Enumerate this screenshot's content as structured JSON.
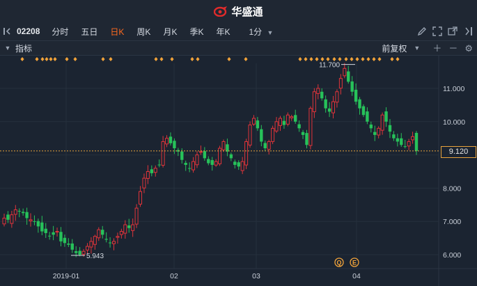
{
  "app": {
    "title": "华盛通"
  },
  "toolbar": {
    "stock_code": "02208",
    "periods": [
      {
        "label": "分时",
        "active": false
      },
      {
        "label": "五日",
        "active": false
      },
      {
        "label": "日K",
        "active": true
      },
      {
        "label": "周K",
        "active": false
      },
      {
        "label": "月K",
        "active": false
      },
      {
        "label": "季K",
        "active": false
      },
      {
        "label": "年K",
        "active": false
      }
    ],
    "minute_select": "1分"
  },
  "indicator_bar": {
    "label": "指标",
    "adjust_mode": "前复权"
  },
  "colors": {
    "up": "#e0343a",
    "down": "#27c25a",
    "accent": "#ff6a1f",
    "marker": "#f1a33a",
    "current_price_line": "#e8a33c"
  },
  "chart_data": {
    "type": "candlestick",
    "y_ticks": [
      "11.000",
      "10.000",
      "9.000",
      "8.000",
      "7.000",
      "6.000"
    ],
    "ylim": [
      5.55,
      12.0
    ],
    "x_ticks": [
      "2019-01",
      "02",
      "03",
      "04"
    ],
    "current_price": "9.120",
    "max_label": "11.700",
    "min_label": "5.943",
    "event_markers": [
      "Q",
      "E"
    ]
  }
}
